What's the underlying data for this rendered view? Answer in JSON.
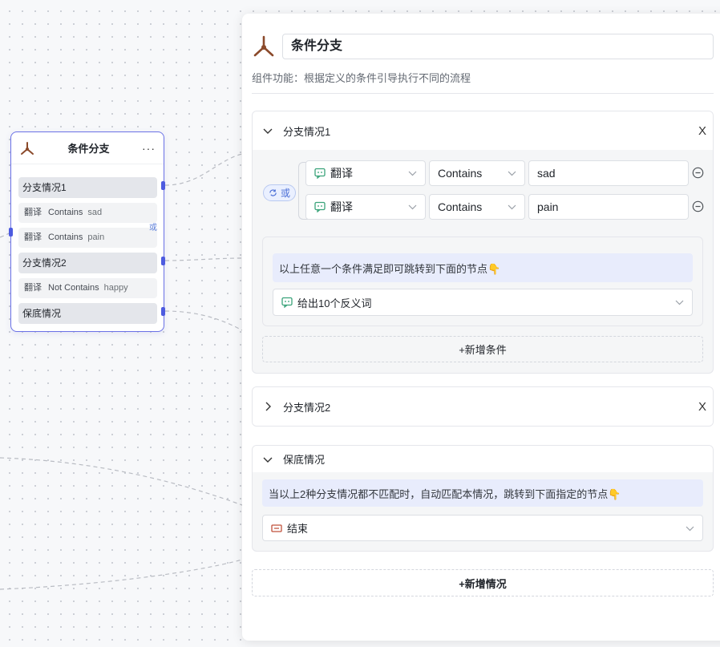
{
  "node": {
    "title": "条件分支",
    "more": "···",
    "case1_label": "分支情况1",
    "cond1": {
      "field": "翻译",
      "op": "Contains",
      "value": "sad"
    },
    "cond2": {
      "field": "翻译",
      "op": "Contains",
      "value": "pain"
    },
    "or_label": "或",
    "case2_label": "分支情况2",
    "cond3": {
      "field": "翻译",
      "op": "Not Contains",
      "value": "happy"
    },
    "default_label": "保底情况"
  },
  "panel": {
    "title": "条件分支",
    "description": "组件功能：根据定义的条件引导执行不同的流程",
    "case1": {
      "label": "分支情况1",
      "close": "X",
      "logic": "或",
      "conditions": [
        {
          "field": "翻译",
          "op": "Contains",
          "value": "sad"
        },
        {
          "field": "翻译",
          "op": "Contains",
          "value": "pain"
        }
      ],
      "hint": "以上任意一个条件满足即可跳转到下面的节点👇",
      "target": "给出10个反义词",
      "add_condition": "+新增条件"
    },
    "case2": {
      "label": "分支情况2",
      "close": "X"
    },
    "default": {
      "label": "保底情况",
      "hint": "当以上2种分支情况都不匹配时，自动匹配本情况，跳转到下面指定的节点👇",
      "target": "结束"
    },
    "add_case": "+新增情况"
  },
  "colors": {
    "accent": "#4d5be0",
    "node_border": "#6b72e6",
    "hint_bg": "#e8ecfc",
    "branch_icon": "#8b4a2b"
  },
  "icons": {
    "branch": "branch-fork-icon",
    "llm": "chat-model-icon",
    "end": "end-node-icon"
  }
}
